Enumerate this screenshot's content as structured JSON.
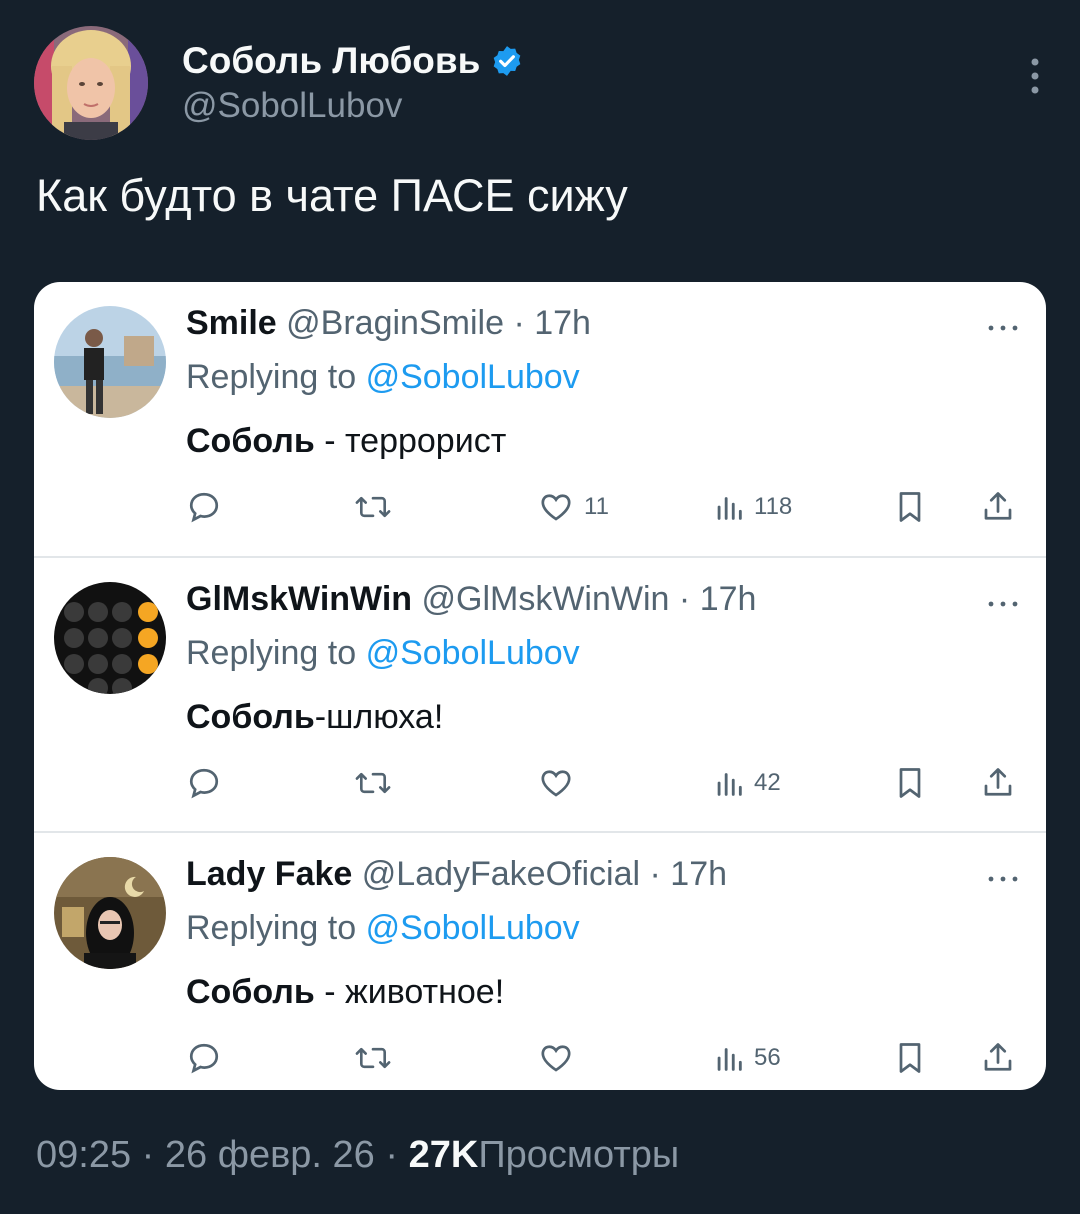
{
  "author": {
    "name": "Соболь Любовь",
    "handle": "@SobolLubov",
    "verified": true
  },
  "tweet": {
    "text": "Как будто в чате ПАСЕ сижу"
  },
  "replies": [
    {
      "name": "Smile",
      "handle": "@BraginSmile",
      "sep": "·",
      "time": "17h",
      "replying_prefix": "Replying to",
      "replying_to": "@SobolLubov",
      "text_bold": "Соболь",
      "text_rest": " - террорист",
      "likes": "11",
      "views": "118"
    },
    {
      "name": "GlMskWinWin",
      "handle": "@GlMskWinWin",
      "sep": "·",
      "time": "17h",
      "replying_prefix": "Replying to",
      "replying_to": "@SobolLubov",
      "text_bold": "Соболь",
      "text_rest": "-шлюха!",
      "likes": "",
      "views": "42"
    },
    {
      "name": "Lady Fake",
      "handle": "@LadyFakeOficial",
      "sep": "·",
      "time": "17h",
      "replying_prefix": "Replying to",
      "replying_to": "@SobolLubov",
      "text_bold": "Соболь",
      "text_rest": " - животное!",
      "likes": "",
      "views": "56"
    }
  ],
  "footer": {
    "time": "09:25",
    "sep1": "·",
    "date": "26 февр. 26",
    "sep2": "·",
    "views_count": "27K",
    "views_label": "Просмотры"
  },
  "colors": {
    "background": "#15202b",
    "accent": "#1d9bf0",
    "muted": "#8b98a5",
    "card": "#ffffff"
  },
  "icons": [
    "verified-icon",
    "more-icon",
    "reply-icon",
    "retweet-icon",
    "like-icon",
    "views-icon",
    "bookmark-icon",
    "share-icon"
  ]
}
